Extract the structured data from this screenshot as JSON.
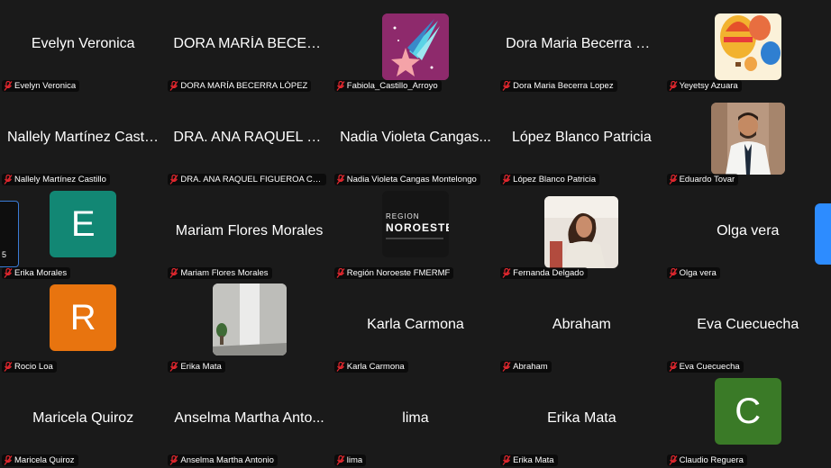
{
  "participants": [
    {
      "display": "Evelyn Veronica",
      "label": "Evelyn Veronica",
      "kind": "name"
    },
    {
      "display": "DORA MARÍA BECERR...",
      "label": "DORA MARÍA BECERRA LÓPEZ",
      "kind": "name"
    },
    {
      "display": "",
      "label": "Fabiola_Castillo_Arroyo",
      "kind": "photo",
      "photo": "shooting-star-icon"
    },
    {
      "display": "Dora Maria Becerra Lo...",
      "label": "Dora Maria Becerra Lopez",
      "kind": "name"
    },
    {
      "display": "",
      "label": "Yeyetsy Azuara",
      "kind": "photo",
      "photo": "hot-air-balloons-image"
    },
    {
      "display": "Nallely Martínez Castillo",
      "label": "Nallely Martínez Castillo",
      "kind": "name"
    },
    {
      "display": "DRA. ANA RAQUEL FI...",
      "label": "DRA. ANA RAQUEL FIGUEROA CHA...",
      "kind": "name"
    },
    {
      "display": "Nadia Violeta Cangas...",
      "label": "Nadia Violeta Cangas Montelongo",
      "kind": "name"
    },
    {
      "display": "López Blanco Patricia",
      "label": "López Blanco Patricia",
      "kind": "name"
    },
    {
      "display": "",
      "label": "Eduardo Tovar",
      "kind": "photo",
      "photo": "man-portrait-image"
    },
    {
      "display": "E",
      "label": "Erika Morales",
      "kind": "avatar",
      "color": "#128774"
    },
    {
      "display": "Mariam Flores Morales",
      "label": "Mariam Flores Morales",
      "kind": "name"
    },
    {
      "display": "",
      "label": "Región Noroeste FMERMF",
      "kind": "photo",
      "photo": "region-noroeste-logo",
      "logo_line1": "REGION",
      "logo_line2": "NOROESTE"
    },
    {
      "display": "",
      "label": "Fernanda Delgado",
      "kind": "photo",
      "photo": "woman-portrait-image"
    },
    {
      "display": "Olga vera",
      "label": "Olga vera",
      "kind": "name"
    },
    {
      "display": "R",
      "label": "Rocio Loa",
      "kind": "avatar",
      "color": "#e8740f"
    },
    {
      "display": "",
      "label": "Erika Mata",
      "kind": "photo",
      "photo": "room-interior-image"
    },
    {
      "display": "Karla Carmona",
      "label": "Karla Carmona",
      "kind": "name"
    },
    {
      "display": "Abraham",
      "label": "Abraham",
      "kind": "name"
    },
    {
      "display": "Eva Cuecuecha",
      "label": "Eva Cuecuecha",
      "kind": "name"
    },
    {
      "display": "Maricela Quiroz",
      "label": "Maricela Quiroz",
      "kind": "name"
    },
    {
      "display": "Anselma Martha Anto...",
      "label": "Anselma Martha Antonio",
      "kind": "name"
    },
    {
      "display": "lima",
      "label": "lima",
      "kind": "name"
    },
    {
      "display": "Erika Mata",
      "label": "Erika Mata",
      "kind": "name"
    },
    {
      "display": "C",
      "label": "Claudio Reguera",
      "kind": "avatar",
      "color": "#3a7a27"
    }
  ],
  "edge_left_text": "5",
  "colors": {
    "background": "#1a1a1a",
    "muted_icon": "#e0272e",
    "accent": "#2d8cff"
  }
}
